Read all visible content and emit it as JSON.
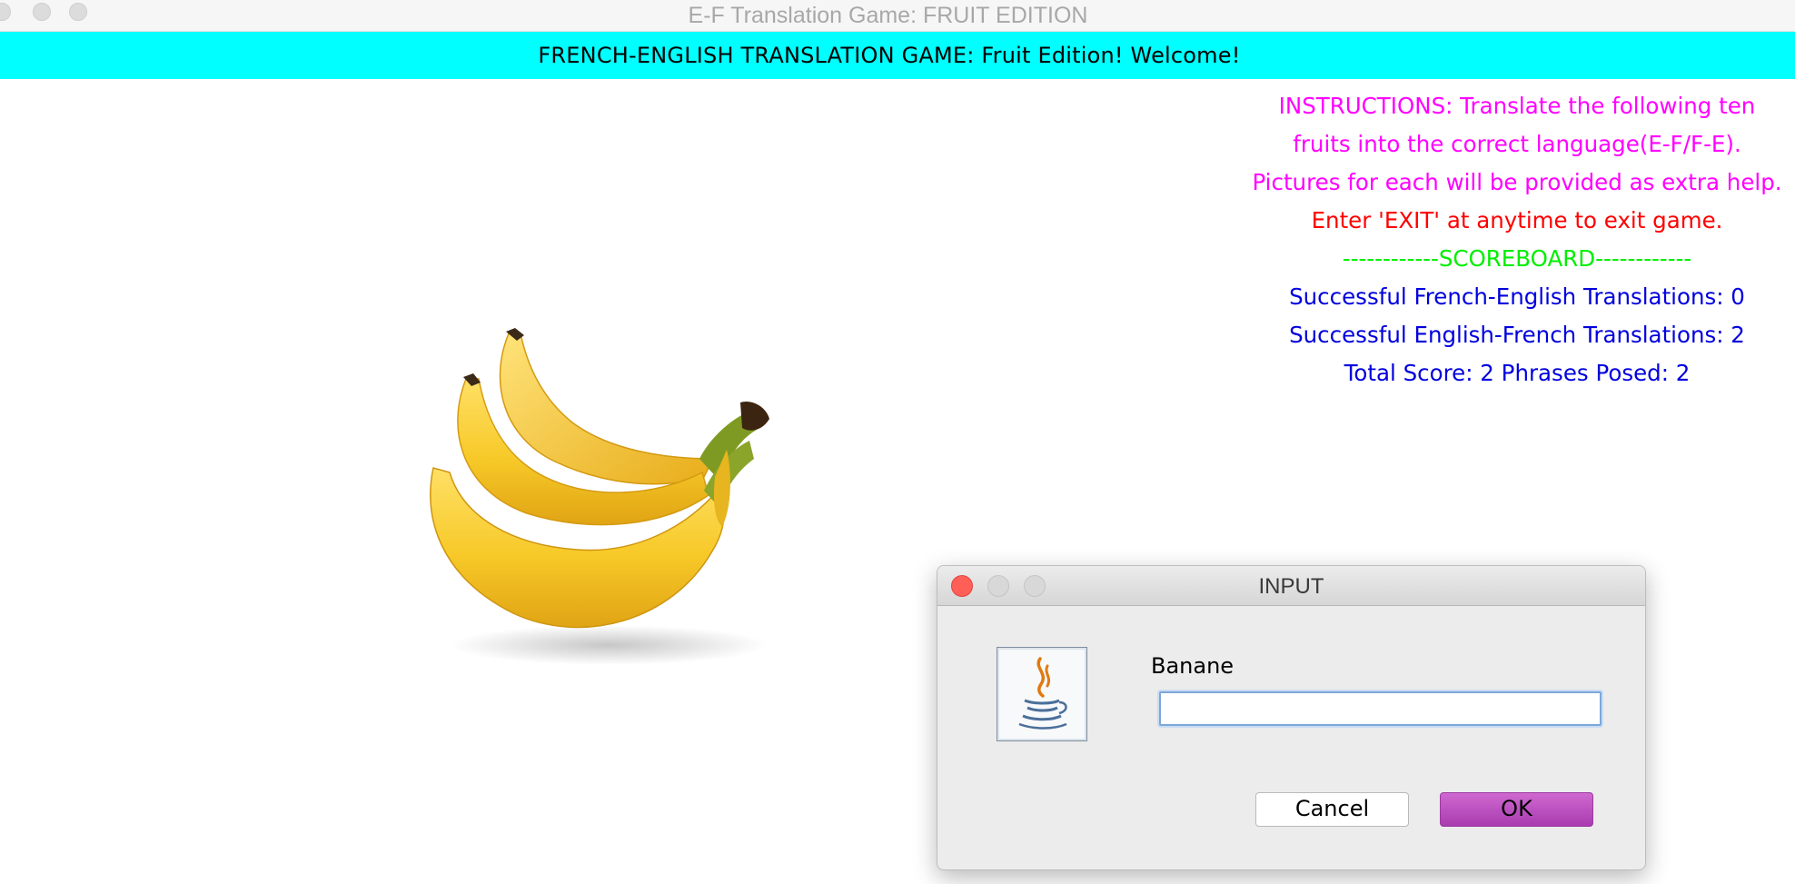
{
  "window": {
    "title": "E-F Translation Game: FRUIT EDITION"
  },
  "banner": {
    "text": "FRENCH-ENGLISH TRANSLATION GAME: Fruit Edition! Welcome!"
  },
  "instructions": {
    "line1": "INSTRUCTIONS: Translate the following ten",
    "line2": "fruits into the correct language(E-F/F-E).",
    "line3": "Pictures for each will be provided as extra help.",
    "exit_note": "Enter 'EXIT' at anytime to exit game."
  },
  "scoreboard": {
    "header": "------------SCOREBOARD------------",
    "french_english": "Successful French-English Translations: 0",
    "english_french": "Successful English-French Translations: 2",
    "total": "Total Score: 2 Phrases Posed: 2"
  },
  "dialog": {
    "title": "INPUT",
    "prompt": "Banane",
    "input_value": "",
    "cancel_label": "Cancel",
    "ok_label": "OK"
  },
  "colors": {
    "banner": "#00ffff",
    "instructions": "#ff00ff",
    "exit_note": "#ff0000",
    "scoreboard_header": "#00ee00",
    "scoreboard_text": "#0000dd",
    "ok_button": "#b94cbd"
  },
  "icons": [
    "java-coffee-icon",
    "banana-image"
  ]
}
